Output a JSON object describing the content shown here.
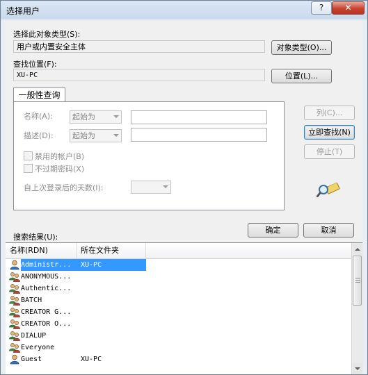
{
  "window": {
    "title": "选择用户",
    "help_label": "?",
    "close_label": "✕"
  },
  "object_type": {
    "label": "选择此对象类型(S):",
    "value": "用户或内置安全主体",
    "button": "对象类型(O)..."
  },
  "location": {
    "label": "查找位置(F):",
    "value": "XU-PC",
    "button": "位置(L)..."
  },
  "tab": {
    "label": "一般性查询"
  },
  "query": {
    "name_label": "名称(A):",
    "name_op": "起始为",
    "desc_label": "描述(D):",
    "desc_op": "起始为",
    "disabled_accounts": "禁用的帐户(B)",
    "non_expiring_pw": "不过期密码(X)",
    "days_label": "自上次登录后的天数(I):"
  },
  "side_buttons": {
    "columns": "列(C)...",
    "find_now": "立即查找(N)",
    "stop": "停止(T)"
  },
  "results": {
    "label": "搜索结果(U):",
    "columns": [
      "名称(RDN)",
      "所在文件夹"
    ],
    "rows": [
      {
        "name": "Administr...",
        "folder": "XU-PC",
        "icon": "user-icon",
        "selected": true
      },
      {
        "name": "ANONYMOUS...",
        "folder": "",
        "icon": "group-icon"
      },
      {
        "name": "Authentic...",
        "folder": "",
        "icon": "group-icon"
      },
      {
        "name": "BATCH",
        "folder": "",
        "icon": "group-icon"
      },
      {
        "name": "CREATOR G...",
        "folder": "",
        "icon": "group-icon"
      },
      {
        "name": "CREATOR O...",
        "folder": "",
        "icon": "group-icon"
      },
      {
        "name": "DIALUP",
        "folder": "",
        "icon": "group-icon"
      },
      {
        "name": "Everyone",
        "folder": "",
        "icon": "group-icon"
      },
      {
        "name": "Guest",
        "folder": "XU-PC",
        "icon": "user-icon"
      }
    ]
  },
  "actions": {
    "ok": "确定",
    "cancel": "取消"
  }
}
